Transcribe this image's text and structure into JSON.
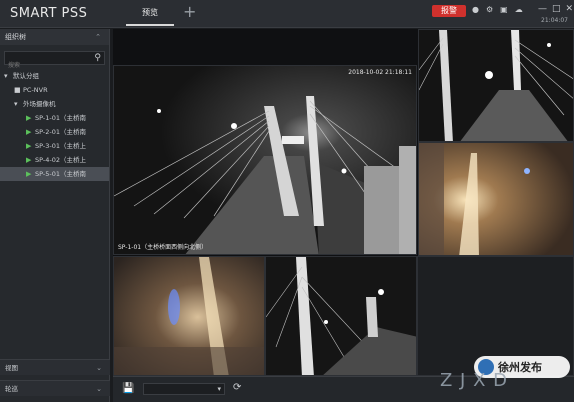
{
  "app": {
    "brand": "SMART PSS"
  },
  "topbar": {
    "tab_label": "预览",
    "add_tab_label": "+",
    "alarm_label": "报警",
    "icons": [
      "user-icon",
      "gear-icon",
      "display-icon",
      "cloud-icon"
    ],
    "window": [
      "minimize",
      "restore",
      "close"
    ],
    "window_glyphs": [
      "—",
      "□",
      "✕"
    ],
    "clock": "21:04:07"
  },
  "sidebar": {
    "header": "组织树",
    "search_placeholder": "搜索",
    "tree": [
      {
        "label": "默认分组",
        "icon": "tree-icon",
        "kind": "group"
      },
      {
        "label": "PC-NVR",
        "icon": "nvr-icon",
        "kind": "device"
      },
      {
        "label": "外场摄像机",
        "icon": "folder-icon",
        "kind": "folder"
      },
      {
        "label": "SP-1-01（主桥南",
        "icon": "camera-icon",
        "kind": "camera"
      },
      {
        "label": "SP-2-01（主桥南",
        "icon": "camera-icon",
        "kind": "camera"
      },
      {
        "label": "SP-3-01（主桥上",
        "icon": "camera-icon",
        "kind": "camera"
      },
      {
        "label": "SP-4-02（主桥上",
        "icon": "camera-icon",
        "kind": "camera"
      },
      {
        "label": "SP-5-01（主桥南",
        "icon": "camera-icon",
        "kind": "camera",
        "selected": true
      }
    ],
    "footer_1": "视图",
    "footer_2": "轮巡"
  },
  "tiles": [
    {
      "timestamp": "2018-10-02 21:18:11",
      "caption": "SP-1-01（主桥桥面西侧向北侧）"
    }
  ],
  "bottombar": {
    "select_value": ""
  },
  "watermark": {
    "site": "Z J X D",
    "badge": "徐州发布"
  }
}
